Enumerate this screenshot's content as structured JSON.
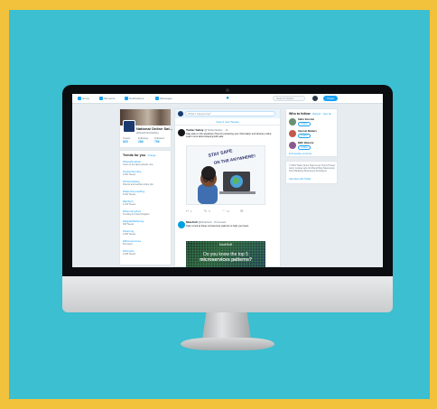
{
  "colors": {
    "frame": "#f2c23c",
    "background": "#3bbfd1",
    "accent": "#1da1f2",
    "monitor_bezel": "#0c0d10",
    "screen_bg": "#e6ecf0"
  },
  "nav": {
    "items": [
      {
        "label": "Home",
        "icon": "home-icon"
      },
      {
        "label": "Moments",
        "icon": "moments-icon"
      },
      {
        "label": "Notifications",
        "icon": "bell-icon"
      },
      {
        "label": "Messages",
        "icon": "mail-icon"
      }
    ],
    "logo_icon": "twitter-bird-icon",
    "search_placeholder": "Search Twitter",
    "tweet_label": "Tweet"
  },
  "profile": {
    "name": "National Online Saf...",
    "handle": "@NatOnlineSafety",
    "stats": [
      {
        "label": "Tweets",
        "value": "820"
      },
      {
        "label": "Following",
        "value": "288"
      },
      {
        "label": "Followers",
        "value": "756"
      }
    ]
  },
  "trends": {
    "title": "Trends for you",
    "change": "· Change",
    "items": [
      {
        "tag": "#NewsPodcast",
        "sub": "Listen to the latest episode now"
      },
      {
        "tag": "#CyberSecurity",
        "sub": "2,391 Tweets"
      },
      {
        "tag": "#OnlineSafety",
        "sub": "Parents and teachers share tips"
      },
      {
        "tag": "#SaferInternetDay",
        "sub": "5,102 Tweets"
      },
      {
        "tag": "#EdTech",
        "sub": "1,234 Tweets"
      },
      {
        "tag": "#ParentingTips",
        "sub": "Trending in United Kingdom"
      },
      {
        "tag": "#DigitalWellbeing",
        "sub": "918 Tweets"
      },
      {
        "tag": "#Gaming",
        "sub": "4,506 Tweets"
      },
      {
        "tag": "#Microservices",
        "sub": "Promoted"
      },
      {
        "tag": "#Schools",
        "sub": "2,018 Tweets"
      }
    ]
  },
  "feed": {
    "compose_placeholder": "What's happening?",
    "new_tweets": "View 2 new Tweets",
    "tweets": [
      {
        "name": "Twitter Safety",
        "handle": "@TwitterSafety · 1h",
        "text": "Stay safe on the anywhere! Tips for protecting your information and devices online. Learn more about keeping kids safe."
      },
      {
        "name": "MuleSoft",
        "handle": "@MuleSoft · Promoted",
        "text": "Take a look at these microservice patterns to help your team."
      }
    ],
    "image_caption_line1": "STAY SAFE",
    "image_caption_line2": "ON THE ANYWHERE!",
    "promo_brand": "MuleSoft",
    "promo_line1": "Do you know the top 5",
    "promo_line2": "microservices patterns?",
    "action_counts": [
      "1",
      "5",
      "12"
    ]
  },
  "who_to_follow": {
    "title": "Who to follow",
    "refresh": "· Refresh · View all",
    "suggestions": [
      {
        "name": "Safer Internet",
        "follow": "Follow"
      },
      {
        "name": "Internet Matters",
        "follow": "Follow"
      },
      {
        "name": "BBC Bitesize",
        "follow": "Follow"
      }
    ],
    "find_friends": "Find people you know"
  },
  "footer": {
    "text": "© 2018 Twitter About Help Center Terms Privacy policy Cookies Ads info Brand Blog Status Apps Jobs Marketing Businesses Developers",
    "ads": "Advertise with Twitter"
  }
}
